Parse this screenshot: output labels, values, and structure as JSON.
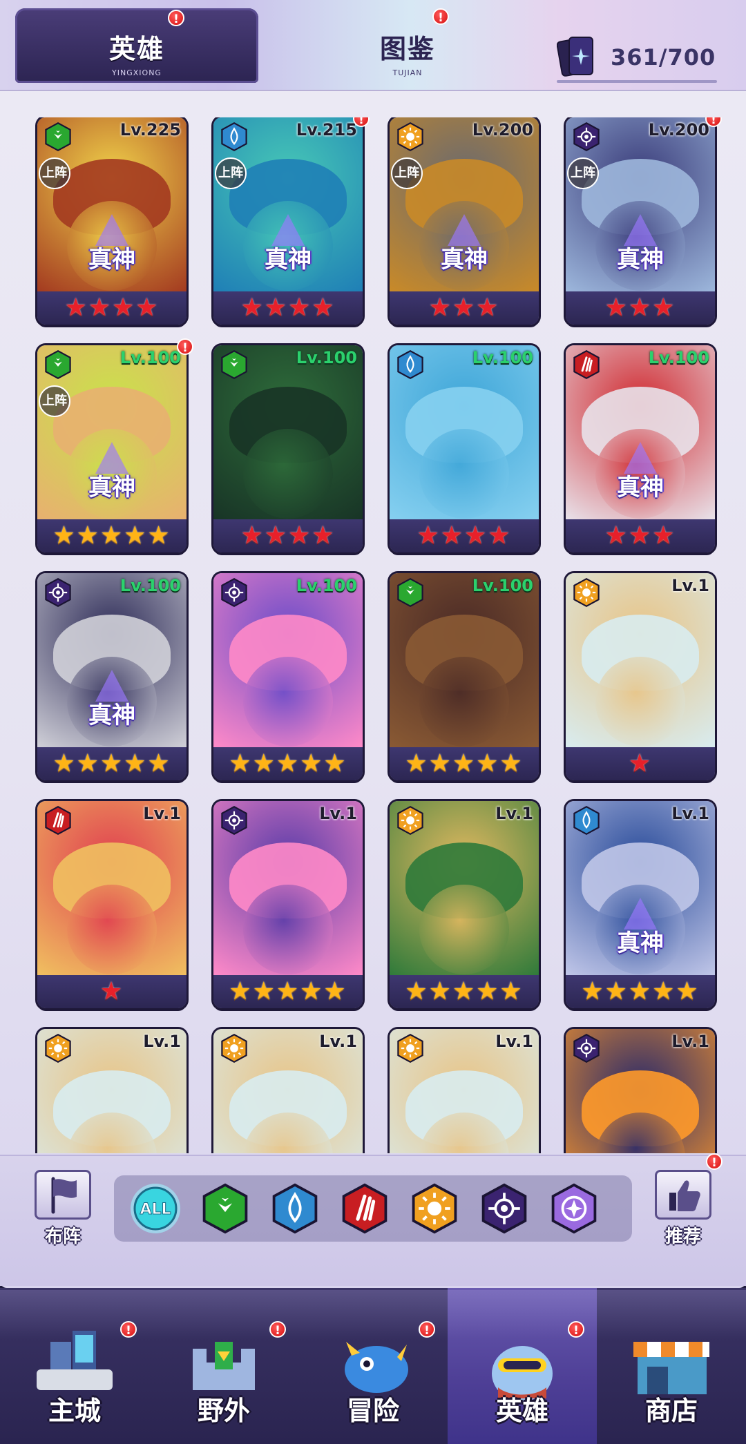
{
  "header": {
    "tabs": [
      {
        "title": "英雄",
        "subtitle": "YINGXIONG",
        "active": true,
        "badge": "!"
      },
      {
        "title": "图鉴",
        "subtitle": "TUJIAN",
        "active": false,
        "badge": "!"
      }
    ],
    "card_count": "361/700",
    "card_icon": "card-collection-icon"
  },
  "heroes": [
    {
      "level": "Lv.225",
      "faction": "nature",
      "stars": 4,
      "star_color": "red",
      "deployed": "上阵",
      "rank": "真神",
      "badge": "",
      "palette": [
        "#f0d24a",
        "#a33a20"
      ]
    },
    {
      "level": "Lv.215",
      "faction": "water",
      "stars": 4,
      "star_color": "red",
      "deployed": "上阵",
      "rank": "真神",
      "badge": "!",
      "palette": [
        "#47c8b6",
        "#1f7fb6"
      ]
    },
    {
      "level": "Lv.200",
      "faction": "light",
      "stars": 3,
      "star_color": "red",
      "deployed": "上阵",
      "rank": "真神",
      "badge": "",
      "palette": [
        "#6b6a6e",
        "#c98a28"
      ]
    },
    {
      "level": "Lv.200",
      "faction": "dark",
      "stars": 3,
      "star_color": "red",
      "deployed": "上阵",
      "rank": "真神",
      "badge": "!",
      "palette": [
        "#3a3c7a",
        "#9db7dc"
      ]
    },
    {
      "level": "Lv.100",
      "faction": "nature",
      "stars": 5,
      "star_color": "gold",
      "deployed": "上阵",
      "rank": "真神",
      "badge": "!",
      "palette": [
        "#c9e24a",
        "#e8b070"
      ]
    },
    {
      "level": "Lv.100",
      "faction": "nature",
      "stars": 4,
      "star_color": "red",
      "deployed": "",
      "rank": "",
      "badge": "",
      "palette": [
        "#2e6c3a",
        "#183426"
      ]
    },
    {
      "level": "Lv.100",
      "faction": "water",
      "stars": 4,
      "star_color": "red",
      "deployed": "",
      "rank": "",
      "badge": "",
      "palette": [
        "#3fa6d8",
        "#86d0f0"
      ]
    },
    {
      "level": "Lv.100",
      "faction": "fire",
      "stars": 3,
      "star_color": "red",
      "deployed": "",
      "rank": "真神",
      "badge": "",
      "palette": [
        "#d02a30",
        "#e8e2ea"
      ]
    },
    {
      "level": "Lv.100",
      "faction": "dark",
      "stars": 5,
      "star_color": "gold",
      "deployed": "",
      "rank": "真神",
      "badge": "",
      "palette": [
        "#2e2c58",
        "#d0d0d8"
      ]
    },
    {
      "level": "Lv.100",
      "faction": "dark",
      "stars": 5,
      "star_color": "gold",
      "deployed": "",
      "rank": "",
      "badge": "",
      "palette": [
        "#6b4cc8",
        "#ff8ac8"
      ]
    },
    {
      "level": "Lv.100",
      "faction": "nature",
      "stars": 5,
      "star_color": "gold",
      "deployed": "",
      "rank": "",
      "badge": "",
      "palette": [
        "#4a2a26",
        "#8a5a34"
      ]
    },
    {
      "level": "Lv.1",
      "faction": "light",
      "stars": 1,
      "star_color": "red",
      "deployed": "",
      "rank": "",
      "badge": "",
      "palette": [
        "#e8c486",
        "#d8ecf0"
      ]
    },
    {
      "level": "Lv.1",
      "faction": "fire",
      "stars": 1,
      "star_color": "red",
      "deployed": "",
      "rank": "",
      "badge": "",
      "palette": [
        "#e04050",
        "#f0c060"
      ]
    },
    {
      "level": "Lv.1",
      "faction": "dark",
      "stars": 5,
      "star_color": "gold",
      "deployed": "",
      "rank": "",
      "badge": "",
      "palette": [
        "#5a3ca8",
        "#ff8ac8"
      ]
    },
    {
      "level": "Lv.1",
      "faction": "light",
      "stars": 5,
      "star_color": "gold",
      "deployed": "",
      "rank": "",
      "badge": "",
      "palette": [
        "#e0b860",
        "#2f7a3a"
      ]
    },
    {
      "level": "Lv.1",
      "faction": "water",
      "stars": 5,
      "star_color": "gold",
      "deployed": "",
      "rank": "真神",
      "badge": "",
      "palette": [
        "#2a4c9a",
        "#c0c6e8"
      ]
    },
    {
      "level": "Lv.1",
      "faction": "light",
      "stars": 0,
      "star_color": "red",
      "deployed": "",
      "rank": "",
      "badge": "",
      "palette": [
        "#e8c486",
        "#d8ecf0"
      ]
    },
    {
      "level": "Lv.1",
      "faction": "light",
      "stars": 0,
      "star_color": "red",
      "deployed": "",
      "rank": "",
      "badge": "",
      "palette": [
        "#e8c486",
        "#d8ecf0"
      ]
    },
    {
      "level": "Lv.1",
      "faction": "light",
      "stars": 0,
      "star_color": "red",
      "deployed": "",
      "rank": "",
      "badge": "",
      "palette": [
        "#e8c486",
        "#d8ecf0"
      ]
    },
    {
      "level": "Lv.1",
      "faction": "dark",
      "stars": 0,
      "star_color": "red",
      "deployed": "",
      "rank": "",
      "badge": "",
      "palette": [
        "#2a2a6a",
        "#ff9a2a"
      ]
    }
  ],
  "filter": {
    "formation_label": "布阵",
    "recommend_label": "推荐",
    "recommend_badge": "!",
    "all_label": "ALL",
    "factions": [
      "all",
      "nature",
      "water",
      "fire",
      "light",
      "dark",
      "arcane"
    ]
  },
  "faction_colors": {
    "nature": "#2aa830",
    "water": "#2f8ad0",
    "fire": "#c81e22",
    "light": "#f0a020",
    "dark": "#3b2370",
    "arcane": "#9a6ae0",
    "all": "#39d5e0"
  },
  "nav": [
    {
      "label": "主城",
      "badge": "!",
      "icon": "city-icon",
      "active": false
    },
    {
      "label": "野外",
      "badge": "!",
      "icon": "field-castle-icon",
      "active": false
    },
    {
      "label": "冒险",
      "badge": "!",
      "icon": "adventure-dragon-icon",
      "active": false
    },
    {
      "label": "英雄",
      "badge": "!",
      "icon": "hero-portrait-icon",
      "active": true
    },
    {
      "label": "商店",
      "badge": "",
      "icon": "shop-icon",
      "active": false
    }
  ]
}
